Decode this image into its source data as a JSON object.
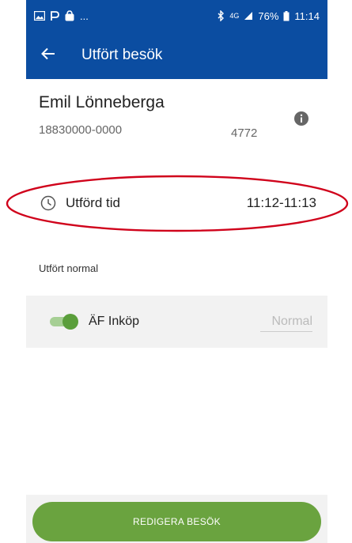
{
  "status_bar": {
    "left_overflow": "...",
    "network": "4G",
    "battery": "76%",
    "time": "11:14"
  },
  "app_bar": {
    "title": "Utfört besök",
    "back_icon": "arrow-left-icon"
  },
  "patient": {
    "name": "Emil Lönneberga",
    "personal_id": "18830000-0000",
    "number": "4772",
    "info_icon": "info-icon"
  },
  "time": {
    "label": "Utförd tid",
    "value": "11:12-11:13",
    "icon": "clock-icon"
  },
  "section": {
    "label": "Utfört normal"
  },
  "activity": {
    "name": "ÄF Inköp",
    "toggle_on": true,
    "placeholder": "Normal"
  },
  "actions": {
    "edit_label": "REDIGERA BESÖK"
  },
  "colors": {
    "primary": "#0b4da1",
    "accent_green": "#6aa33f",
    "highlight_red": "#d0021b"
  }
}
